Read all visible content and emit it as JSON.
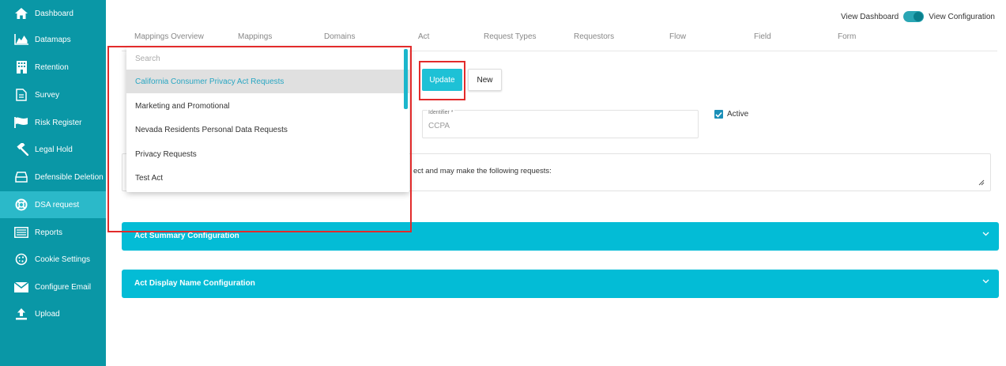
{
  "sidebar": {
    "items": [
      {
        "label": "Dashboard",
        "icon": "home-icon"
      },
      {
        "label": "Datamaps",
        "icon": "area-chart-icon"
      },
      {
        "label": "Retention",
        "icon": "building-icon"
      },
      {
        "label": "Survey",
        "icon": "document-icon"
      },
      {
        "label": "Risk Register",
        "icon": "flag-icon"
      },
      {
        "label": "Legal Hold",
        "icon": "gavel-icon"
      },
      {
        "label": "Defensible Deletion",
        "icon": "drive-icon"
      },
      {
        "label": "DSA request",
        "icon": "life-ring-icon"
      },
      {
        "label": "Reports",
        "icon": "list-icon"
      },
      {
        "label": "Cookie Settings",
        "icon": "cookie-icon"
      },
      {
        "label": "Configure Email",
        "icon": "envelope-icon"
      },
      {
        "label": "Upload",
        "icon": "upload-icon"
      }
    ],
    "active_index": 7
  },
  "topbar": {
    "view_dashboard": "View Dashboard",
    "view_configuration": "View Configuration"
  },
  "tabs": [
    "Mappings Overview",
    "Mappings",
    "Domains",
    "Act",
    "Request Types",
    "Requestors",
    "Flow",
    "Field",
    "Form"
  ],
  "actions": {
    "update": "Update",
    "new": "New"
  },
  "form": {
    "identifier_label": "Identifier *",
    "identifier_value": "CCPA",
    "active_label": "Active",
    "description_text": "ect and may make the following requests:"
  },
  "accordions": [
    {
      "title": "Act Summary Configuration"
    },
    {
      "title": "Act Display Name Configuration"
    }
  ],
  "dropdown": {
    "search_placeholder": "Search",
    "options": [
      "California Consumer Privacy Act Requests",
      "Marketing and Promotional",
      "Nevada Residents Personal Data Requests",
      "Privacy Requests",
      "Test Act"
    ],
    "selected_index": 0
  },
  "colors": {
    "sidebar": "#0a97a6",
    "sidebar_active": "#2bb9c9",
    "accent": "#03bcd6",
    "highlight_box": "#e22b2b",
    "selected_text": "#29a6c2"
  }
}
